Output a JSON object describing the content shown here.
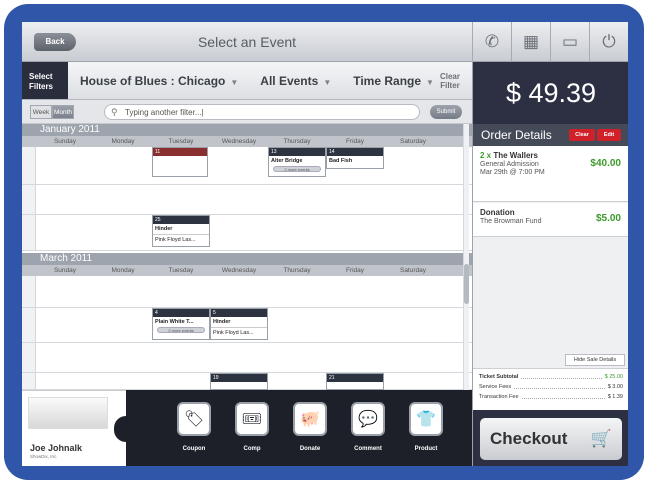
{
  "topbar": {
    "back_label": "Back",
    "title": "Select an Event",
    "icons": [
      "phone-icon",
      "keypad-icon",
      "window-icon",
      "power-icon"
    ]
  },
  "filters": {
    "select_label": "Select Filters",
    "venue": "House of Blues : Chicago",
    "events": "All Events",
    "time": "Time Range",
    "clear": "Clear Filter"
  },
  "view": {
    "week_label": "Week",
    "month_label": "Month",
    "search_value": "Typing another filter...|",
    "submit_label": "Submit"
  },
  "calendar": {
    "days": [
      "Sunday",
      "Monday",
      "Tuesday",
      "Wednesday",
      "Thursday",
      "Friday",
      "Saturday"
    ],
    "jan": {
      "title": "January 2011",
      "events": [
        {
          "date": "13",
          "name": "Alter Bridge",
          "more": "2 more events"
        },
        {
          "date": "14",
          "name": "Bad Fish"
        },
        {
          "date": "25",
          "name": "Hinder",
          "sub": "Pink Floyd Las..."
        },
        {
          "date": "11"
        }
      ]
    },
    "mar": {
      "title": "March 2011",
      "events": [
        {
          "date": "4",
          "name": "Plain White T...",
          "more": "2 more events"
        },
        {
          "date": "5",
          "name": "Hinder",
          "sub": "Pink Floyd Las..."
        },
        {
          "date": "19"
        },
        {
          "date": "21"
        }
      ]
    }
  },
  "order": {
    "total": "$ 49.39",
    "header": "Order Details",
    "clear_label": "Clear",
    "edit_label": "Edit",
    "items": [
      {
        "qty": "2 x",
        "name": "The Wallers",
        "sub1": "General Admission",
        "sub2": "Mar 29th @ 7:00 PM",
        "price": "$40.00"
      },
      {
        "name": "Donation",
        "sub1": "The Browman Fund",
        "price": "$5.00"
      }
    ],
    "hide_label": "Hide Sale Details",
    "subtotal_label": "Ticket Subtotal",
    "subtotal": "$ 25.00",
    "service_label": "Service Fees",
    "service": "$ 3.00",
    "txn_label": "Transaction Fee",
    "txn": "$ 1.39",
    "checkout_label": "Checkout"
  },
  "user": {
    "name": "Joe Johnalk",
    "org": "ShowDix, Inc."
  },
  "tray": {
    "buttons": [
      {
        "label": "Coupon",
        "icon": "tag-icon"
      },
      {
        "label": "Comp",
        "icon": "ticket-icon"
      },
      {
        "label": "Donate",
        "icon": "piggy-bank-icon"
      },
      {
        "label": "Comment",
        "icon": "speech-bubble-icon"
      },
      {
        "label": "Product",
        "icon": "tshirt-icon"
      }
    ]
  },
  "colors": {
    "accent_green": "#3d9a2c",
    "accent_red": "#d0202a",
    "dark": "#2c3042"
  }
}
